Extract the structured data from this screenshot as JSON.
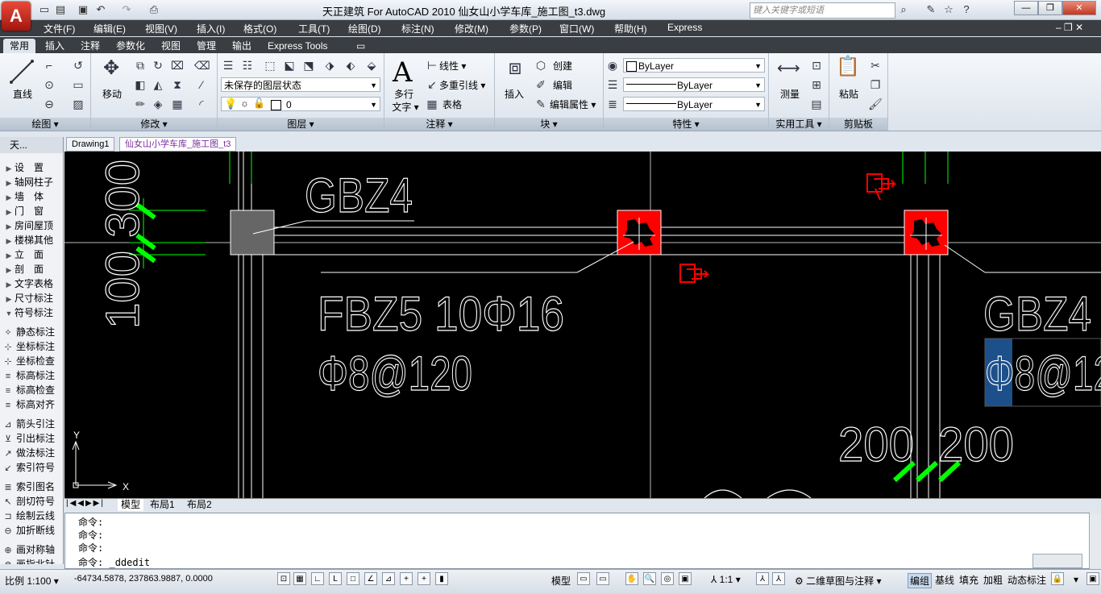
{
  "title": {
    "text": "天正建筑 For AutoCAD 2010      仙女山小学车库_施工图_t3.dwg",
    "search_placeholder": "键入关键字或短语"
  },
  "menu": [
    "文件(F)",
    "编辑(E)",
    "视图(V)",
    "插入(I)",
    "格式(O)",
    "工具(T)",
    "绘图(D)",
    "标注(N)",
    "修改(M)",
    "参数(P)",
    "窗口(W)",
    "帮助(H)",
    "Express"
  ],
  "ribbon_tabs": [
    "常用",
    "插入",
    "注释",
    "参数化",
    "视图",
    "管理",
    "输出",
    "Express Tools"
  ],
  "ribbon": {
    "draw": {
      "title": "绘图",
      "line": "直线"
    },
    "modify": {
      "title": "修改",
      "move": "移动"
    },
    "layer": {
      "title": "图层",
      "state": "未保存的图层状态",
      "current": "0"
    },
    "annotation": {
      "title": "注释",
      "mtext_1": "多行",
      "mtext_2": "文字",
      "linear": "线性",
      "mleader": "多重引线",
      "table": "表格"
    },
    "block": {
      "title": "块",
      "insert": "插入",
      "create": "创建",
      "edit": "编辑",
      "edit_attr": "编辑属性"
    },
    "properties": {
      "title": "特性",
      "color": "ByLayer",
      "linetype": "ByLayer",
      "lineweight": "ByLayer"
    },
    "utilities": {
      "title": "实用工具",
      "measure": "测量"
    },
    "clipboard": {
      "title": "剪贴板",
      "paste": "粘贴"
    }
  },
  "doc_tabs": [
    "Drawing1",
    "仙女山小学车库_施工图_t3"
  ],
  "palette": {
    "header": "天...",
    "items": [
      {
        "label": "设　置",
        "type": "tri"
      },
      {
        "label": "轴网柱子",
        "type": "tri"
      },
      {
        "label": "墙　体",
        "type": "tri"
      },
      {
        "label": "门　窗",
        "type": "tri"
      },
      {
        "label": "房间屋顶",
        "type": "tri"
      },
      {
        "label": "楼梯其他",
        "type": "tri"
      },
      {
        "label": "立　面",
        "type": "tri"
      },
      {
        "label": "剖　面",
        "type": "tri"
      },
      {
        "label": "文字表格",
        "type": "tri"
      },
      {
        "label": "尺寸标注",
        "type": "tri"
      },
      {
        "label": "符号标注",
        "type": "open"
      },
      {
        "label": "静态标注",
        "type": "icon"
      },
      {
        "label": "坐标标注",
        "type": "icon"
      },
      {
        "label": "坐标检查",
        "type": "icon"
      },
      {
        "label": "标高标注",
        "type": "icon"
      },
      {
        "label": "标高检查",
        "type": "icon"
      },
      {
        "label": "标高对齐",
        "type": "icon"
      },
      {
        "label": "箭头引注",
        "type": "icon"
      },
      {
        "label": "引出标注",
        "type": "icon"
      },
      {
        "label": "做法标注",
        "type": "icon"
      },
      {
        "label": "索引符号",
        "type": "icon"
      },
      {
        "label": "索引图名",
        "type": "icon"
      },
      {
        "label": "剖切符号",
        "type": "icon"
      },
      {
        "label": "绘制云线",
        "type": "icon"
      },
      {
        "label": "加折断线",
        "type": "icon"
      },
      {
        "label": "画对称轴",
        "type": "icon"
      },
      {
        "label": "画指北针",
        "type": "icon"
      }
    ]
  },
  "drawing": {
    "text_gbz4_left": "GBZ4",
    "text_fbz5": "FBZ5 10Φ16",
    "text_phi8_left": "Φ8@120",
    "text_gbz4_right": "GBZ4",
    "text_phi8_right": "Φ8@12",
    "text_dim_vert": "100 300",
    "text_dim_200a": "200",
    "text_dim_200b": "200",
    "ucs_y": "Y",
    "ucs_x": "X"
  },
  "layout_tabs": [
    "模型",
    "布局1",
    "布局2"
  ],
  "command": {
    "lines": [
      "命令:",
      "命令:",
      "命令:"
    ],
    "prompt": "命令:",
    "input": "_ddedit"
  },
  "status": {
    "scale": "比例 1:100",
    "coords": "-64734.5878, 237863.9887, 0.0000",
    "model": "模型",
    "annot_scale": "1:1",
    "workspace": "二维草图与注释",
    "toggles": [
      "编组",
      "基线",
      "填充",
      "加粗",
      "动态标注"
    ]
  },
  "colors": {
    "accent_red": "#ff0000",
    "accent_green": "#00ff00",
    "canvas": "#000000",
    "highlight": "#1d4f8a"
  }
}
